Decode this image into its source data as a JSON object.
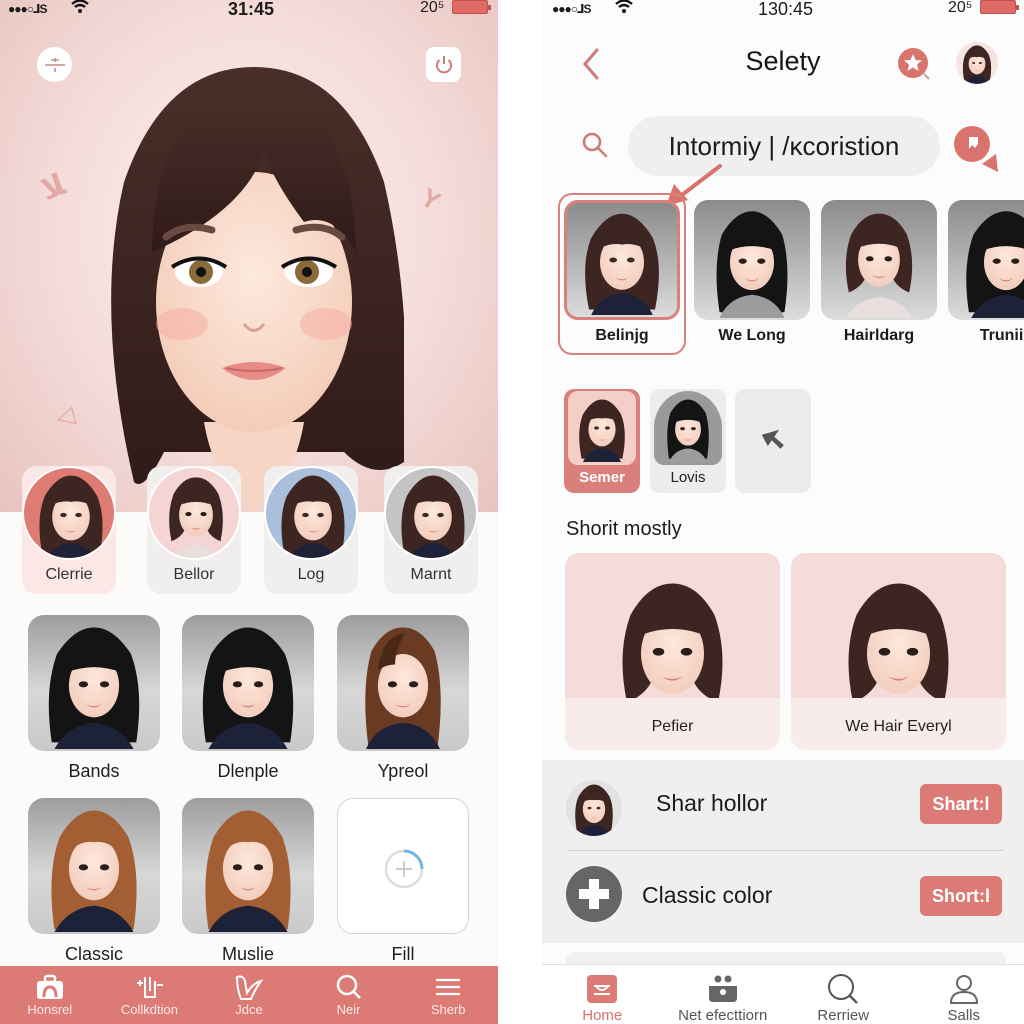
{
  "colors": {
    "accent": "#dc7a76",
    "accent_dark": "#c85e59",
    "hero_bg": "#f4dcd9",
    "panel_gray": "#efefef",
    "hair_brown": "#3d2522",
    "hair_black": "#141414",
    "hair_auburn": "#9a5a34"
  },
  "left_phone": {
    "status_bar": {
      "signal": "●●●○ᒧS",
      "time": "31:45",
      "battery_pct": "20⁵"
    },
    "top_left_icon": "divide-icon",
    "top_right_icon": "power-icon",
    "featured_styles": [
      {
        "label": "Clerrie",
        "active": true
      },
      {
        "label": "Bellor",
        "active": false
      },
      {
        "label": "Log",
        "active": false
      },
      {
        "label": "Marnt",
        "active": false
      }
    ],
    "grid": [
      {
        "label": "Bands"
      },
      {
        "label": "Dlenple"
      },
      {
        "label": "Ypreol"
      },
      {
        "label": "Classic"
      },
      {
        "label": "Muslie"
      },
      {
        "label": "Fill",
        "is_add": true
      }
    ],
    "bottom_nav": [
      {
        "label": "Honsrel",
        "icon": "bag-icon"
      },
      {
        "label": "Collkdtion",
        "icon": "collection-icon"
      },
      {
        "label": "Jdce",
        "icon": "hand-icon"
      },
      {
        "label": "Neir",
        "icon": "search-icon"
      },
      {
        "label": "Sherb",
        "icon": "menu-icon"
      }
    ]
  },
  "right_phone": {
    "status_bar": {
      "signal": "●●●○ᒧS",
      "time": "130:45",
      "battery_pct": "20⁵"
    },
    "header": {
      "title": "Selety",
      "back_icon": "chevron-left-icon",
      "favorite_icon": "star-badge-icon",
      "avatar_icon": "user-avatar"
    },
    "search": {
      "value": "Intormiy | /κcoristion",
      "icon": "search-icon",
      "action_icon": "puzzle-badge-icon"
    },
    "style_carousel": [
      {
        "label": "Belinjg",
        "selected": true
      },
      {
        "label": "We Long",
        "selected": false
      },
      {
        "label": "Hairldarg",
        "selected": false
      },
      {
        "label": "Truniie",
        "selected": false
      }
    ],
    "mini_options": [
      {
        "label": "Semer",
        "active": true
      },
      {
        "label": "Lovis",
        "active": false
      },
      {
        "label": "",
        "icon": "cursor-icon"
      }
    ],
    "section_title": "Shorit mostly",
    "featured_cards": [
      {
        "label": "Pefier"
      },
      {
        "label": "We Hair Everyl"
      }
    ],
    "list": [
      {
        "title": "Shar hollor",
        "button": "Shart:l",
        "leading": "avatar"
      },
      {
        "title": "Classic color",
        "button": "Short:l",
        "leading": "plus-icon"
      }
    ],
    "bottom_nav": [
      {
        "label": "Home",
        "icon": "home-icon",
        "active": true
      },
      {
        "label": "Net efecttiorn",
        "icon": "faces-icon",
        "active": false
      },
      {
        "label": "Rerriew",
        "icon": "search-icon",
        "active": false
      },
      {
        "label": "Salls",
        "icon": "user-icon",
        "active": false
      }
    ]
  }
}
